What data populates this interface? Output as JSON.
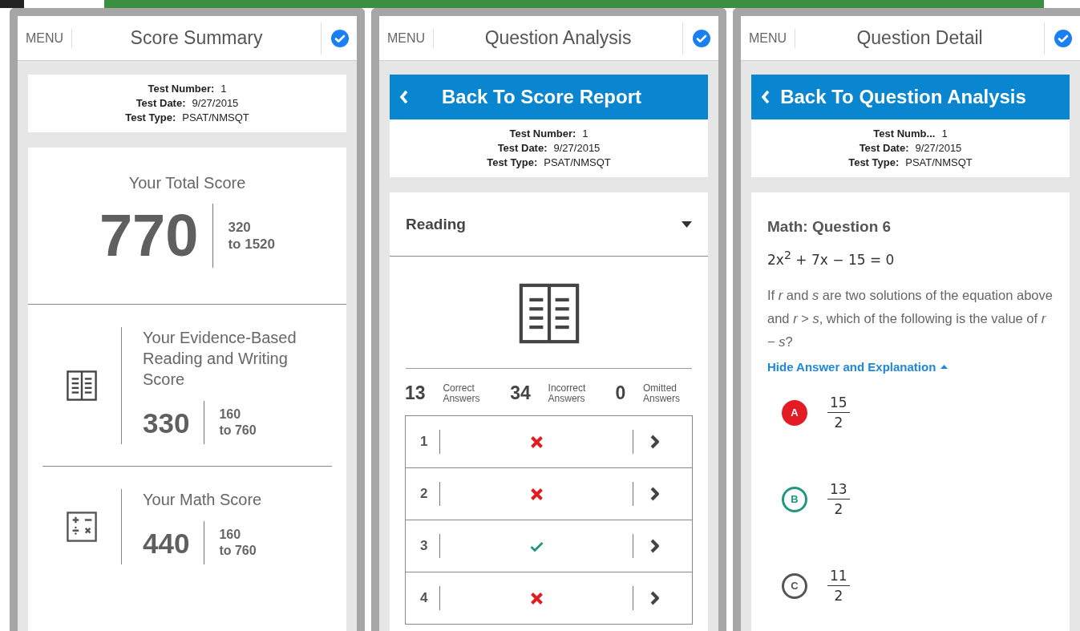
{
  "panels": [
    {
      "kind": "summary",
      "menu": "MENU",
      "title": "Score Summary",
      "checked": true,
      "info": [
        {
          "label": "Test Number:",
          "value": "1"
        },
        {
          "label": "Test Date:",
          "value": "9/27/2015"
        },
        {
          "label": "Test Type:",
          "value": "PSAT/NMSQT"
        }
      ],
      "total": {
        "title": "Your Total Score",
        "score": "770",
        "range": [
          "320",
          "to 1520"
        ]
      },
      "subscores": [
        {
          "kind": "reading",
          "title": "Your Evidence-Based Reading and Writing Score",
          "score": "330",
          "range": [
            "160",
            "to 760"
          ]
        },
        {
          "kind": "math",
          "title": "Your Math Score",
          "score": "440",
          "range": [
            "160",
            "to 760"
          ]
        }
      ]
    },
    {
      "kind": "analysis",
      "menu": "MENU",
      "title": "Question Analysis",
      "checked": true,
      "back": "Back To Score Report",
      "info": [
        {
          "label": "Test Number:",
          "value": "1"
        },
        {
          "label": "Test Date:",
          "value": "9/27/2015"
        },
        {
          "label": "Test Type:",
          "value": "PSAT/NMSQT"
        }
      ],
      "section": "Reading",
      "stats": [
        {
          "count": "13",
          "label": "Correct Answers"
        },
        {
          "count": "34",
          "label": "Incorrect Answers"
        },
        {
          "count": "0",
          "label": "Omitted Answers"
        }
      ],
      "questions": [
        {
          "number": "1",
          "correct": false
        },
        {
          "number": "2",
          "correct": false
        },
        {
          "number": "3",
          "correct": true
        },
        {
          "number": "4",
          "correct": false
        }
      ]
    },
    {
      "kind": "detail",
      "menu": "MENU",
      "title": "Question Detail",
      "checked": true,
      "back": "Back To Question Analysis",
      "info": [
        {
          "label": "Test Numb...",
          "value": "1"
        },
        {
          "label": "Test Date:",
          "value": "9/27/2015"
        },
        {
          "label": "Test Type:",
          "value": "PSAT/NMSQT"
        }
      ],
      "question_title": "Math: Question 6",
      "equation": "2x$^{2}$ + 7x − 15 = 0",
      "question": "If *r* and *s* are two solutions of the equation above and *r* > *s*, which of the following is the value of *r* − *s*?",
      "toggle": "Hide Answer and Explanation",
      "choices": [
        {
          "letter": "A",
          "kind": "incorrect",
          "numerator": "15",
          "denominator": "2"
        },
        {
          "letter": "B",
          "kind": "correct",
          "numerator": "13",
          "denominator": "2"
        },
        {
          "letter": "C",
          "kind": "plain",
          "numerator": "11",
          "denominator": "2"
        }
      ]
    }
  ]
}
